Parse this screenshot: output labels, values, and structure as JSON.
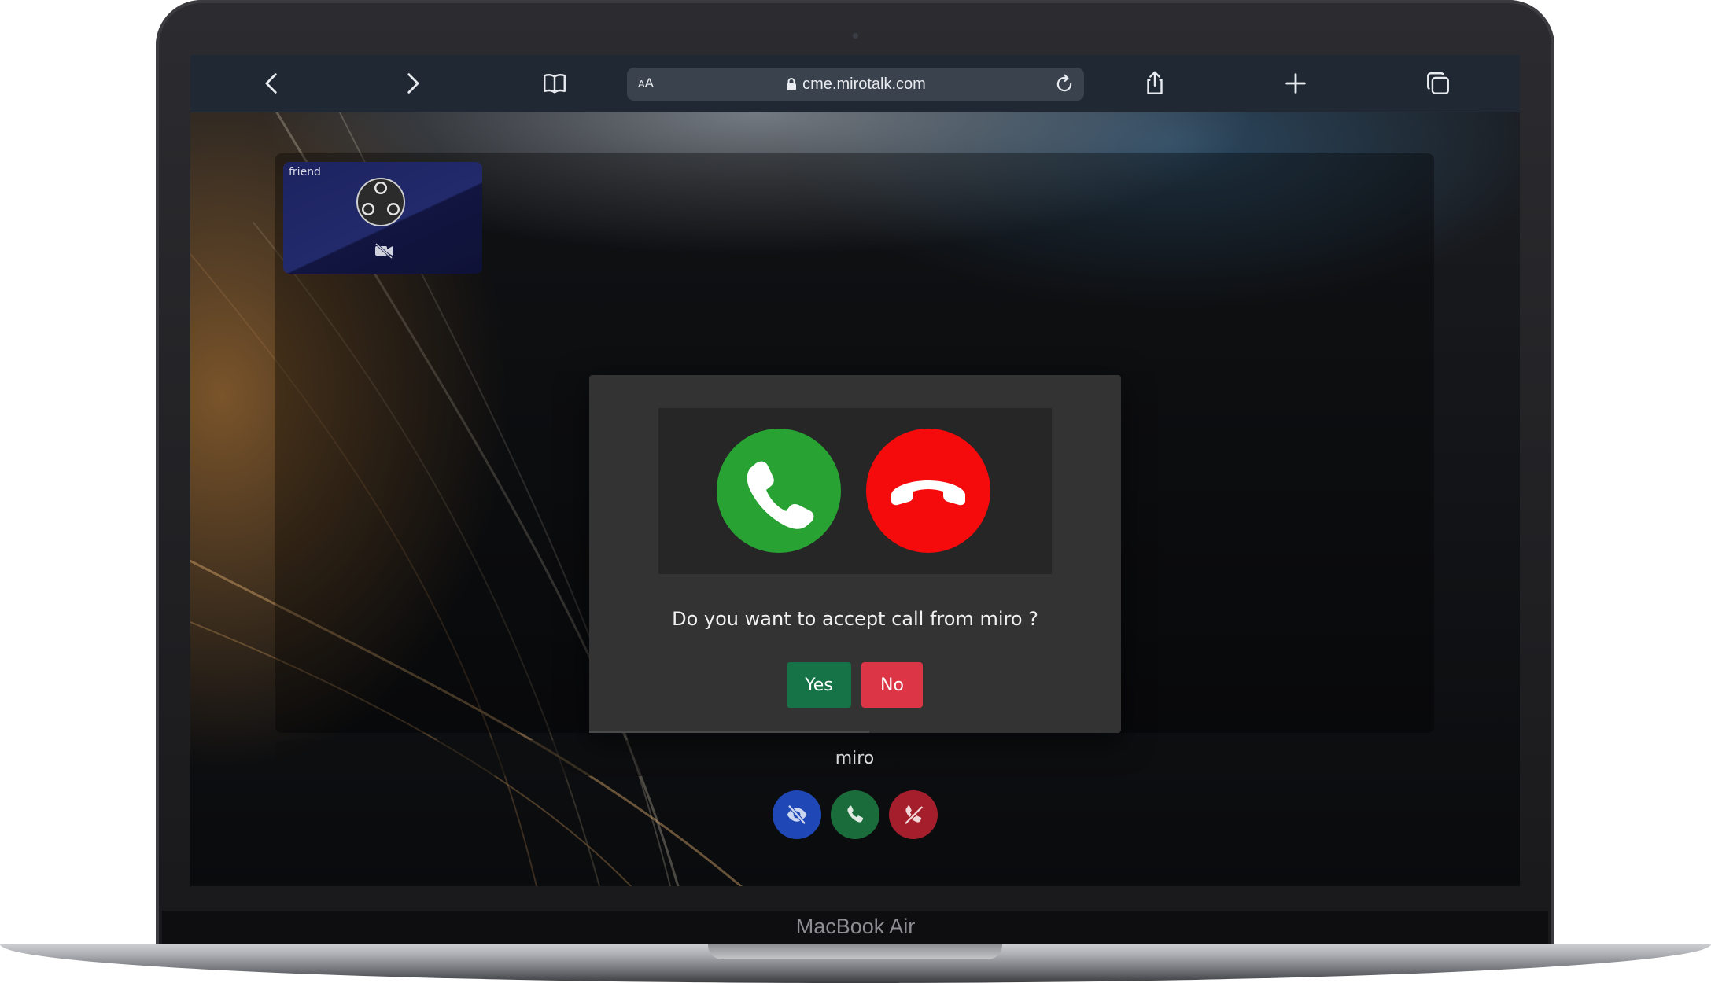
{
  "device": {
    "label": "MacBook Air"
  },
  "browser": {
    "url": "cme.mirotalk.com",
    "reader_label_big": "A",
    "reader_label_small": "A",
    "icons": [
      "back-icon",
      "forward-icon",
      "bookmarks-icon",
      "lock-icon",
      "reload-icon",
      "share-icon",
      "new-tab-icon",
      "tabs-icon"
    ]
  },
  "peer_thumbnail": {
    "name": "friend"
  },
  "incoming_call": {
    "question": "Do you want to accept call from miro ?",
    "yes_label": "Yes",
    "no_label": "No"
  },
  "caller": {
    "name": "miro"
  },
  "colors": {
    "accept_green": "#27a233",
    "decline_red": "#f50b0b",
    "yes_button": "#157347",
    "no_button": "#dc3545",
    "hide_button": "#1f48b6",
    "call_button": "#1a6d3a",
    "end_button": "#a41f2b"
  }
}
